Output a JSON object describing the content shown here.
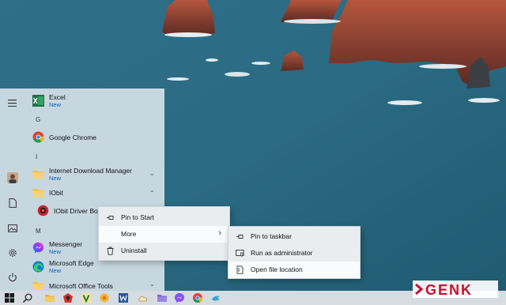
{
  "start_menu": {
    "apps": [
      {
        "name": "Excel",
        "sub": "New",
        "icon": "excel-icon"
      },
      {
        "letter": "G"
      },
      {
        "name": "Google Chrome",
        "icon": "chrome-icon"
      },
      {
        "letter": "I"
      },
      {
        "name": "Internet Download Manager",
        "sub": "New",
        "icon": "folder-icon",
        "expand": "collapsed"
      },
      {
        "name": "IObit",
        "icon": "folder-icon",
        "expand": "expanded"
      },
      {
        "name": "IObit Driver Boo",
        "icon": "iobit-driver-booster-icon"
      },
      {
        "letter": "M"
      },
      {
        "name": "Messenger",
        "sub": "New",
        "icon": "messenger-icon"
      },
      {
        "name": "Microsoft Edge",
        "sub": "New",
        "icon": "edge-icon"
      },
      {
        "name": "Microsoft Office Tools",
        "icon": "folder-icon",
        "expand": "collapsed"
      }
    ],
    "rail_icons": [
      "hamburger-menu-icon",
      "user-avatar",
      "documents-icon",
      "pictures-icon",
      "settings-gear-icon",
      "power-icon"
    ]
  },
  "context_menu": {
    "items": [
      {
        "label": "Pin to Start",
        "icon": "pin-icon"
      },
      {
        "label": "More",
        "has_submenu": true,
        "highlighted": true
      },
      {
        "label": "Uninstall",
        "icon": "trash-icon"
      }
    ]
  },
  "more_submenu": {
    "items": [
      {
        "label": "Pin to taskbar",
        "icon": "pin-icon"
      },
      {
        "label": "Run as administrator",
        "icon": "admin-shield-icon"
      },
      {
        "label": "Open file location",
        "icon": "file-location-icon",
        "highlighted": true
      }
    ]
  },
  "taskbar": {
    "items": [
      "windows-start-icon",
      "search-icon",
      "file-explorer-icon",
      "app-red-icon",
      "app-green-v-icon",
      "app-yellow-icon",
      "word-icon",
      "app-cloud-icon",
      "app-folder-icon",
      "messenger-icon",
      "chrome-icon",
      "app-bird-icon"
    ]
  },
  "watermark": {
    "text": "GENK"
  },
  "colors": {
    "accent_new": "#0a5fb4",
    "menu_bg": "#cedce4",
    "context_bg": "#e9edf0"
  }
}
